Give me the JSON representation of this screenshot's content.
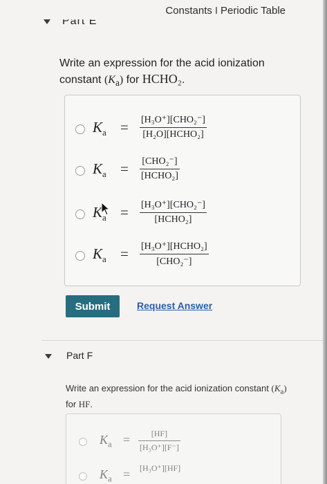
{
  "header": {
    "constants_link": "Constants",
    "separator": "I",
    "periodic_table_link": "Periodic Table"
  },
  "partE": {
    "title": "Part E",
    "question_prefix": "Write an expression for the acid ionization constant",
    "ka_open": "(",
    "ka_symbol": "K",
    "ka_sub": "a",
    "ka_close": ")",
    "question_for": "for",
    "compound": "HCHO₂",
    "period": ".",
    "options": [
      {
        "numerator": "[H₃O⁺][CHO₂⁻]",
        "denominator": "[H₂O][HCHO₂]"
      },
      {
        "numerator": "[CHO₂⁻]",
        "denominator": "[HCHO₂]"
      },
      {
        "numerator": "[H₃O⁺][CHO₂⁻]",
        "denominator": "[HCHO₂]"
      },
      {
        "numerator": "[H₃O⁺][HCHO₂]",
        "denominator": "[CHO₂⁻]"
      }
    ],
    "ka_label": "K",
    "ka_label_sub": "a",
    "equals": "=",
    "submit_label": "Submit",
    "request_answer_label": "Request Answer"
  },
  "partF": {
    "title": "Part F",
    "question_prefix": "Write an expression for the acid ionization constant",
    "ka_open": "(",
    "ka_symbol": "K",
    "ka_sub": "a",
    "ka_close": ")",
    "question_for": "for",
    "compound": "HF",
    "period": ".",
    "options": [
      {
        "numerator": "[HF]",
        "denominator": "[H₃O⁺][F⁻]"
      },
      {
        "numerator": "[H₃O⁺][HF]",
        "denominator": ""
      }
    ]
  },
  "colors": {
    "submit_bg": "#276d80",
    "link": "#2a5ea8"
  }
}
